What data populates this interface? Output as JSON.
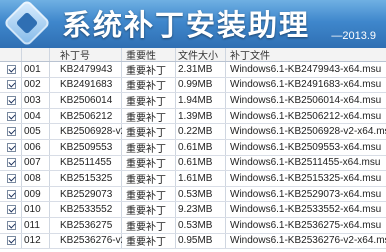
{
  "header": {
    "title": "系统补丁安装助理",
    "version": "—2013.9"
  },
  "table": {
    "columns": {
      "index": "",
      "kb": "补丁号",
      "importance": "重要性",
      "size": "文件大小",
      "file": "补丁文件"
    },
    "rows": [
      {
        "checked": true,
        "index": "001",
        "kb": "KB2479943",
        "importance": "重要补丁",
        "size": "2.31MB",
        "file": "Windows6.1-KB2479943-x64.msu"
      },
      {
        "checked": true,
        "index": "002",
        "kb": "KB2491683",
        "importance": "重要补丁",
        "size": "0.99MB",
        "file": "Windows6.1-KB2491683-x64.msu"
      },
      {
        "checked": true,
        "index": "003",
        "kb": "KB2506014",
        "importance": "重要补丁",
        "size": "1.94MB",
        "file": "Windows6.1-KB2506014-x64.msu"
      },
      {
        "checked": true,
        "index": "004",
        "kb": "KB2506212",
        "importance": "重要补丁",
        "size": "1.39MB",
        "file": "Windows6.1-KB2506212-x64.msu"
      },
      {
        "checked": true,
        "index": "005",
        "kb": "KB2506928-v2",
        "importance": "重要补丁",
        "size": "0.22MB",
        "file": "Windows6.1-KB2506928-v2-x64.msu"
      },
      {
        "checked": true,
        "index": "006",
        "kb": "KB2509553",
        "importance": "重要补丁",
        "size": "0.61MB",
        "file": "Windows6.1-KB2509553-x64.msu"
      },
      {
        "checked": true,
        "index": "007",
        "kb": "KB2511455",
        "importance": "重要补丁",
        "size": "0.61MB",
        "file": "Windows6.1-KB2511455-x64.msu"
      },
      {
        "checked": true,
        "index": "008",
        "kb": "KB2515325",
        "importance": "重要补丁",
        "size": "1.61MB",
        "file": "Windows6.1-KB2515325-x64.msu"
      },
      {
        "checked": true,
        "index": "009",
        "kb": "KB2529073",
        "importance": "重要补丁",
        "size": "0.53MB",
        "file": "Windows6.1-KB2529073-x64.msu"
      },
      {
        "checked": true,
        "index": "010",
        "kb": "KB2533552",
        "importance": "重要补丁",
        "size": "9.23MB",
        "file": "Windows6.1-KB2533552-x64.msu"
      },
      {
        "checked": true,
        "index": "011",
        "kb": "KB2536275",
        "importance": "重要补丁",
        "size": "0.53MB",
        "file": "Windows6.1-KB2536275-x64.msu"
      },
      {
        "checked": true,
        "index": "012",
        "kb": "KB2536276-v2",
        "importance": "重要补丁",
        "size": "0.95MB",
        "file": "Windows6.1-KB2536276-v2-x64.msu"
      }
    ]
  },
  "colors": {
    "banner_top": "#6fb0e3",
    "banner_bottom": "#2f6fb3",
    "grid_line": "#d8dde6"
  }
}
